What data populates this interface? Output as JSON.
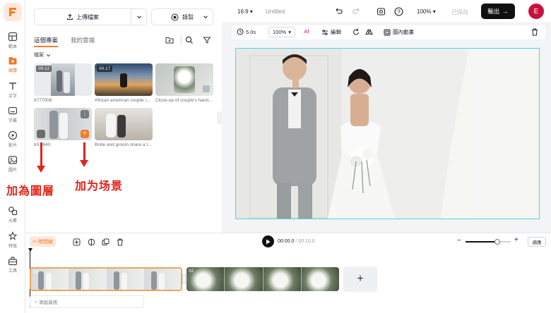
{
  "rail": {
    "items": [
      {
        "label": "範本",
        "icon": "template-icon"
      },
      {
        "label": "媒體",
        "icon": "media-icon",
        "active": true
      },
      {
        "label": "文字",
        "icon": "text-icon"
      },
      {
        "label": "字幕",
        "icon": "subtitle-icon"
      },
      {
        "label": "影片",
        "icon": "video-icon"
      },
      {
        "label": "圖片",
        "icon": "image-icon"
      },
      {
        "label": "元素",
        "icon": "elements-icon"
      },
      {
        "label": "特效",
        "icon": "effects-icon"
      },
      {
        "label": "工具",
        "icon": "tools-icon"
      }
    ]
  },
  "panel": {
    "upload_label": "上傳檔案",
    "record_label": "錄製",
    "tabs": [
      "這個專案",
      "我的雲端"
    ],
    "section_label": "檔案",
    "media": [
      {
        "name": "8777008",
        "duration": "00:12"
      },
      {
        "name": "African american couple i...",
        "duration": "00:17"
      },
      {
        "name": "Close-up of couple's hand...",
        "duration": ""
      },
      {
        "name": "63.8640",
        "duration": ""
      },
      {
        "name": "Bride and groom share a t...",
        "duration": ""
      }
    ]
  },
  "annotations": {
    "layer": "加為圖層",
    "scene": "加为场景"
  },
  "topbar": {
    "aspect": "16:9",
    "title": "Untitled",
    "zoom": "100%",
    "saved": "已保存",
    "export": "輸出",
    "avatar": "E"
  },
  "edit_toolbar": {
    "duration": "5.0s",
    "scale": "100%",
    "edit": "編輯",
    "animation": "圖內動畫"
  },
  "timeline": {
    "badge": "時間線",
    "current_time": "00:00.0",
    "total_time": "/ 00:10.0",
    "fit": "適應",
    "audio": "添加音訊",
    "clips": [
      "01",
      "02"
    ],
    "zoom_level": 0.7
  },
  "colors": {
    "accent": "#f47b2a",
    "selection": "#4fd4e0",
    "annotation": "#e0251a"
  }
}
